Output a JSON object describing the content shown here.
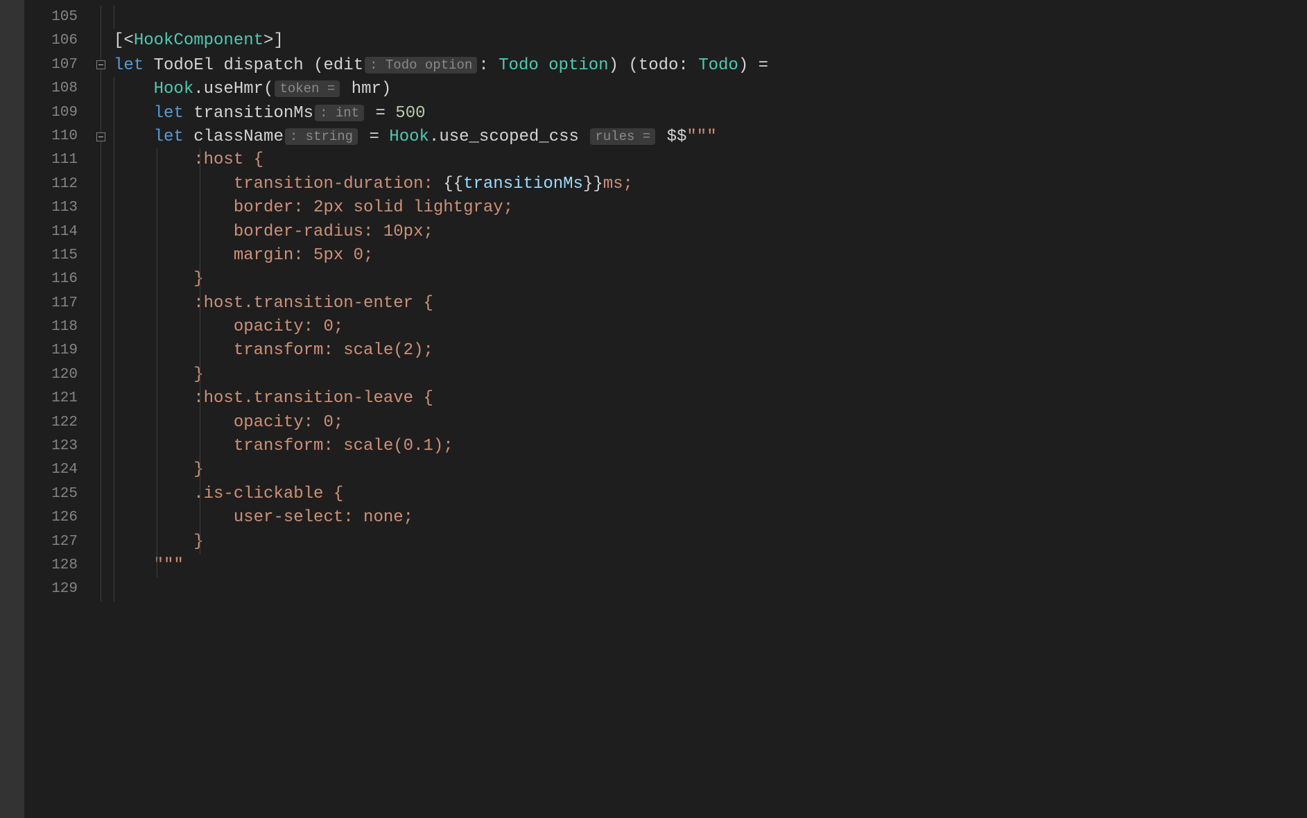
{
  "firstLine": 105,
  "lines": [
    {
      "n": 105,
      "fold": "line",
      "guides": [
        1
      ],
      "tokens": [
        {
          "t": "",
          "c": ""
        }
      ]
    },
    {
      "n": 106,
      "fold": "line",
      "guides": [],
      "tokens": [
        {
          "t": "[<",
          "c": "tok-punct"
        },
        {
          "t": "HookComponent",
          "c": "tok-type"
        },
        {
          "t": ">]",
          "c": "tok-punct"
        }
      ]
    },
    {
      "n": 107,
      "fold": "box",
      "guides": [],
      "tokens": [
        {
          "t": "let",
          "c": "tok-keyword"
        },
        {
          "t": " ",
          "c": ""
        },
        {
          "t": "TodoEl",
          "c": "tok-ident"
        },
        {
          "t": " ",
          "c": ""
        },
        {
          "t": "dispatch",
          "c": "tok-ident"
        },
        {
          "t": " (",
          "c": "tok-punct"
        },
        {
          "t": "edit",
          "c": "tok-ident"
        },
        {
          "t": ": Todo option",
          "c": "inlay"
        },
        {
          "t": ": ",
          "c": "tok-punct"
        },
        {
          "t": "Todo option",
          "c": "tok-type"
        },
        {
          "t": ") (",
          "c": "tok-punct"
        },
        {
          "t": "todo",
          "c": "tok-ident"
        },
        {
          "t": ": ",
          "c": "tok-punct"
        },
        {
          "t": "Todo",
          "c": "tok-type"
        },
        {
          "t": ") =",
          "c": "tok-punct"
        }
      ]
    },
    {
      "n": 108,
      "fold": "line",
      "guides": [
        1
      ],
      "indent": "    ",
      "tokens": [
        {
          "t": "Hook",
          "c": "tok-type"
        },
        {
          "t": ".",
          "c": "tok-punct"
        },
        {
          "t": "useHmr",
          "c": "tok-method"
        },
        {
          "t": "(",
          "c": "tok-punct"
        },
        {
          "t": "token =",
          "c": "inlay"
        },
        {
          "t": " ",
          "c": ""
        },
        {
          "t": "hmr",
          "c": "tok-ident"
        },
        {
          "t": ")",
          "c": "tok-punct"
        }
      ]
    },
    {
      "n": 109,
      "fold": "line",
      "guides": [
        1
      ],
      "indent": "    ",
      "tokens": [
        {
          "t": "let",
          "c": "tok-keyword"
        },
        {
          "t": " ",
          "c": ""
        },
        {
          "t": "transitionMs",
          "c": "tok-ident"
        },
        {
          "t": ": int",
          "c": "inlay"
        },
        {
          "t": " = ",
          "c": "tok-punct"
        },
        {
          "t": "500",
          "c": "tok-number"
        }
      ]
    },
    {
      "n": 110,
      "fold": "box",
      "guides": [
        1
      ],
      "indent": "    ",
      "tokens": [
        {
          "t": "let",
          "c": "tok-keyword"
        },
        {
          "t": " ",
          "c": ""
        },
        {
          "t": "className",
          "c": "tok-ident"
        },
        {
          "t": ": string",
          "c": "inlay"
        },
        {
          "t": " = ",
          "c": "tok-punct"
        },
        {
          "t": "Hook",
          "c": "tok-type"
        },
        {
          "t": ".",
          "c": "tok-punct"
        },
        {
          "t": "use_scoped_css",
          "c": "tok-method"
        },
        {
          "t": " ",
          "c": ""
        },
        {
          "t": "rules =",
          "c": "inlay"
        },
        {
          "t": " ",
          "c": ""
        },
        {
          "t": "$$",
          "c": "tok-punct"
        },
        {
          "t": "\"\"\"",
          "c": "tok-string"
        }
      ]
    },
    {
      "n": 111,
      "fold": "line",
      "guides": [
        1,
        2,
        3
      ],
      "indent": "        ",
      "tokens": [
        {
          "t": ":host {",
          "c": "tok-string-css"
        }
      ]
    },
    {
      "n": 112,
      "fold": "line",
      "guides": [
        1,
        2,
        3
      ],
      "indent": "            ",
      "tokens": [
        {
          "t": "transition-duration: ",
          "c": "tok-string-css"
        },
        {
          "t": "{{",
          "c": "tok-punct"
        },
        {
          "t": "transitionMs",
          "c": "tok-interp"
        },
        {
          "t": "}}",
          "c": "tok-punct"
        },
        {
          "t": "ms;",
          "c": "tok-string-css"
        }
      ]
    },
    {
      "n": 113,
      "fold": "line",
      "guides": [
        1,
        2,
        3
      ],
      "indent": "            ",
      "tokens": [
        {
          "t": "border: 2px solid lightgray;",
          "c": "tok-string-css"
        }
      ]
    },
    {
      "n": 114,
      "fold": "line",
      "guides": [
        1,
        2,
        3
      ],
      "indent": "            ",
      "tokens": [
        {
          "t": "border-radius: 10px;",
          "c": "tok-string-css"
        }
      ]
    },
    {
      "n": 115,
      "fold": "line",
      "guides": [
        1,
        2,
        3
      ],
      "indent": "            ",
      "tokens": [
        {
          "t": "margin: 5px 0;",
          "c": "tok-string-css"
        }
      ]
    },
    {
      "n": 116,
      "fold": "line",
      "guides": [
        1,
        2,
        3
      ],
      "indent": "        ",
      "tokens": [
        {
          "t": "}",
          "c": "tok-string-css"
        }
      ]
    },
    {
      "n": 117,
      "fold": "line",
      "guides": [
        1,
        2,
        3
      ],
      "indent": "        ",
      "tokens": [
        {
          "t": ":host.transition-enter {",
          "c": "tok-string-css"
        }
      ]
    },
    {
      "n": 118,
      "fold": "line",
      "guides": [
        1,
        2,
        3
      ],
      "indent": "            ",
      "tokens": [
        {
          "t": "opacity: 0;",
          "c": "tok-string-css"
        }
      ]
    },
    {
      "n": 119,
      "fold": "line",
      "guides": [
        1,
        2,
        3
      ],
      "indent": "            ",
      "tokens": [
        {
          "t": "transform: scale(2);",
          "c": "tok-string-css"
        }
      ]
    },
    {
      "n": 120,
      "fold": "line",
      "guides": [
        1,
        2,
        3
      ],
      "indent": "        ",
      "tokens": [
        {
          "t": "}",
          "c": "tok-string-css"
        }
      ]
    },
    {
      "n": 121,
      "fold": "line",
      "guides": [
        1,
        2,
        3
      ],
      "indent": "        ",
      "tokens": [
        {
          "t": ":host.transition-leave {",
          "c": "tok-string-css"
        }
      ]
    },
    {
      "n": 122,
      "fold": "line",
      "guides": [
        1,
        2,
        3
      ],
      "indent": "            ",
      "tokens": [
        {
          "t": "opacity: 0;",
          "c": "tok-string-css"
        }
      ]
    },
    {
      "n": 123,
      "fold": "line",
      "guides": [
        1,
        2,
        3
      ],
      "indent": "            ",
      "tokens": [
        {
          "t": "transform: scale(0.1);",
          "c": "tok-string-css"
        }
      ]
    },
    {
      "n": 124,
      "fold": "line",
      "guides": [
        1,
        2,
        3
      ],
      "indent": "        ",
      "tokens": [
        {
          "t": "}",
          "c": "tok-string-css"
        }
      ]
    },
    {
      "n": 125,
      "fold": "line",
      "guides": [
        1,
        2,
        3
      ],
      "indent": "        ",
      "tokens": [
        {
          "t": ".is-clickable {",
          "c": "tok-string-css"
        }
      ]
    },
    {
      "n": 126,
      "fold": "line",
      "guides": [
        1,
        2,
        3
      ],
      "indent": "            ",
      "tokens": [
        {
          "t": "user-select: none;",
          "c": "tok-string-css"
        }
      ]
    },
    {
      "n": 127,
      "fold": "line",
      "guides": [
        1,
        2,
        3
      ],
      "indent": "        ",
      "tokens": [
        {
          "t": "}",
          "c": "tok-string-css"
        }
      ]
    },
    {
      "n": 128,
      "fold": "corner",
      "guides": [
        1,
        2
      ],
      "indent": "    ",
      "tokens": [
        {
          "t": "\"\"\"",
          "c": "tok-string"
        }
      ]
    },
    {
      "n": 129,
      "fold": "line",
      "guides": [
        1
      ],
      "tokens": []
    }
  ]
}
